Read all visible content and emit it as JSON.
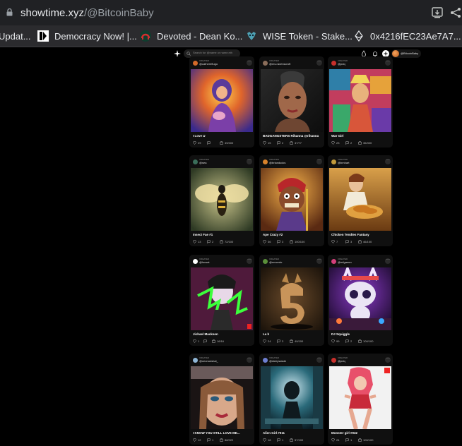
{
  "browser": {
    "url_host": "showtime.xyz",
    "url_path": "/@BitcoinBaby"
  },
  "bookmarks": [
    {
      "label": "Updat...",
      "icon": "globe-icon"
    },
    {
      "label": "Democracy Now! |...",
      "icon": "democracy-now-icon"
    },
    {
      "label": "Devoted - Dean Ko...",
      "icon": "devoted-icon"
    },
    {
      "label": "WISE Token - Stake...",
      "icon": "wise-icon"
    },
    {
      "label": "0x4216fEC23Ae7A7...",
      "icon": "ethereum-icon"
    }
  ],
  "site": {
    "search_placeholder": "Search for @name or name.eth",
    "username": "@BitcoinBaby"
  },
  "cards": [
    {
      "tag": "CREATED",
      "handle": "@cathereflugo",
      "title": "I Love U",
      "likes": "29",
      "comments": "",
      "editions": "49/400",
      "avatar_color": "#d46a2a"
    },
    {
      "tag": "CREATED",
      "handle": "@ms.ravenscroft",
      "title": "BADGANGSTERS Rihanna @rihanna",
      "likes": "15",
      "comments": "2",
      "editions": "47/77",
      "avatar_color": "#8a6d5a"
    },
    {
      "tag": "CREATED",
      "handle": "@pdq",
      "title": "War Girl",
      "likes": "23",
      "comments": "2",
      "editions": "36/300",
      "avatar_color": "#c9302c"
    },
    {
      "tag": "CREATED",
      "handle": "@sea",
      "title": "Insect Fae #1",
      "likes": "13",
      "comments": "2",
      "editions": "72/100",
      "avatar_color": "#3b6e5a"
    },
    {
      "tag": "CREATED",
      "handle": "@brianducks",
      "title": "Ape Crazy #2",
      "likes": "36",
      "comments": "3",
      "editions": "100/100",
      "avatar_color": "#d9822b"
    },
    {
      "tag": "CREATED",
      "handle": "@bmhart",
      "title": "Chicken Tendies Fantasy",
      "likes": "7",
      "comments": "3",
      "editions": "46/100",
      "avatar_color": "#c29a3b"
    },
    {
      "tag": "CREATED",
      "handle": "@lucsat",
      "title": "Jichael Mackson",
      "likes": "1",
      "comments": "",
      "editions": "16/16",
      "avatar_color": "#ffffff"
    },
    {
      "tag": "CREATED",
      "handle": "@nmcedo",
      "title": "La h",
      "likes": "24",
      "comments": "3",
      "editions": "49/100",
      "avatar_color": "#5a8f3a"
    },
    {
      "tag": "CREATED",
      "handle": "@mfgamm",
      "title": "DJ Squiggle",
      "likes": "99",
      "comments": "2",
      "editions": "100/100",
      "avatar_color": "#d23f7a"
    },
    {
      "tag": "CREATED",
      "handle": "@ceonunshai_",
      "title": "I KNOW YOU STILL LOVE ME...",
      "likes": "12",
      "comments": "1",
      "editions": "88/222",
      "avatar_color": "#8fb6d6"
    },
    {
      "tag": "CREATED",
      "handle": "@sleepwaste",
      "title": "Alien Girl #011",
      "likes": "18",
      "comments": "1",
      "editions": "57/100",
      "avatar_color": "#6e7fd1"
    },
    {
      "tag": "CREATED",
      "handle": "@pdq",
      "title": "Monster girl #032",
      "likes": "24",
      "comments": "1",
      "editions": "100/100",
      "avatar_color": "#c9302c"
    }
  ]
}
